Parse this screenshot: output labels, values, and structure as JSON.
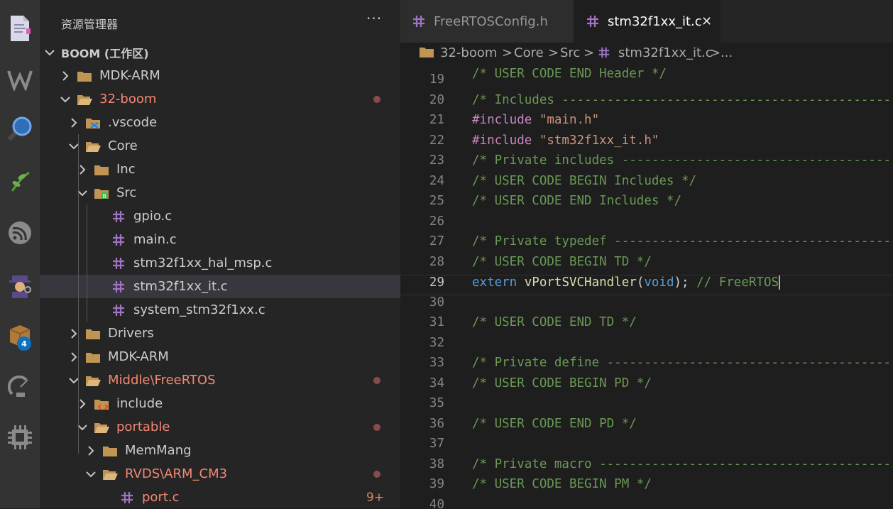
{
  "sidebar": {
    "title": "资源管理器",
    "more": "···",
    "workspace": "BOOM (工作区)",
    "items": [
      {
        "label": "MDK-ARM",
        "color": "#cccccc",
        "chev": "right",
        "icon": "folder-icon"
      },
      {
        "label": "32-boom",
        "color": "#f48771",
        "chev": "down",
        "icon": "folder-open-icon",
        "dot": true
      },
      {
        "label": ".vscode",
        "color": "#cccccc",
        "chev": "right",
        "icon": "vscode-folder-icon"
      },
      {
        "label": "Core",
        "color": "#cccccc",
        "chev": "down",
        "icon": "folder-open-icon"
      },
      {
        "label": "Inc",
        "color": "#cccccc",
        "chev": "right",
        "icon": "folder-icon"
      },
      {
        "label": "Src",
        "color": "#cccccc",
        "chev": "down",
        "icon": "src-folder-icon"
      },
      {
        "label": "gpio.c",
        "color": "#cccccc",
        "icon": "c-file-icon"
      },
      {
        "label": "main.c",
        "color": "#cccccc",
        "icon": "c-file-icon"
      },
      {
        "label": "stm32f1xx_hal_msp.c",
        "color": "#cccccc",
        "icon": "c-file-icon"
      },
      {
        "label": "stm32f1xx_it.c",
        "color": "#cccccc",
        "icon": "c-file-icon",
        "selected": true
      },
      {
        "label": "system_stm32f1xx.c",
        "color": "#cccccc",
        "icon": "c-file-icon"
      },
      {
        "label": "Drivers",
        "color": "#cccccc",
        "chev": "right",
        "icon": "folder-icon"
      },
      {
        "label": "MDK-ARM",
        "color": "#cccccc",
        "chev": "right",
        "icon": "folder-icon"
      },
      {
        "label": "Middle\\FreeRTOS",
        "color": "#f48771",
        "chev": "down",
        "icon": "folder-open-icon",
        "dot": true
      },
      {
        "label": "include",
        "color": "#cccccc",
        "chev": "right",
        "icon": "include-folder-icon"
      },
      {
        "label": "portable",
        "color": "#f48771",
        "chev": "down",
        "icon": "folder-open-icon",
        "dot": true
      },
      {
        "label": "MemMang",
        "color": "#cccccc",
        "chev": "right",
        "icon": "folder-icon"
      },
      {
        "label": "RVDS\\ARM_CM3",
        "color": "#f48771",
        "chev": "down",
        "icon": "folder-open-icon",
        "dot": true
      },
      {
        "label": "port.c",
        "color": "#f48771",
        "icon": "c-file-icon",
        "count": "9+"
      }
    ]
  },
  "activity": {
    "badge": "4",
    "icons": [
      "explorer-icon",
      "wakatime-icon",
      "search-icon",
      "git-branch-icon",
      "espressif-icon",
      "spy-icon",
      "extensions-icon",
      "satellite-icon",
      "chip-icon"
    ]
  },
  "tabs": [
    {
      "label": "FreeRTOSConfig.h",
      "active": false
    },
    {
      "label": "stm32f1xx_it.c",
      "active": true,
      "close": "✕"
    }
  ],
  "breadcrumb": {
    "parts": [
      "32-boom",
      "Core",
      "Src",
      "stm32f1xx_it.c",
      "..."
    ],
    "sep": ">"
  },
  "code": {
    "current_line": 29,
    "top_fragment": "/* USER CODE END Header */",
    "lines": [
      {
        "n": "19",
        "segs": []
      },
      {
        "n": "20",
        "segs": [
          {
            "t": "/* Includes ------------------------------------------------------------------*/",
            "c": "c-cmt"
          }
        ]
      },
      {
        "n": "21",
        "segs": [
          {
            "t": "#include ",
            "c": "c-inc"
          },
          {
            "t": "\"main.h\"",
            "c": "c-str"
          }
        ]
      },
      {
        "n": "22",
        "segs": [
          {
            "t": "#include ",
            "c": "c-inc"
          },
          {
            "t": "\"stm32f1xx_it.h\"",
            "c": "c-str"
          }
        ]
      },
      {
        "n": "23",
        "segs": [
          {
            "t": "/* Private includes ----------------------------------------------------------*/",
            "c": "c-cmt"
          }
        ]
      },
      {
        "n": "24",
        "segs": [
          {
            "t": "/* USER CODE BEGIN Includes */",
            "c": "c-cmt"
          }
        ]
      },
      {
        "n": "25",
        "segs": [
          {
            "t": "/* USER CODE END Includes */",
            "c": "c-cmt"
          }
        ]
      },
      {
        "n": "26",
        "segs": []
      },
      {
        "n": "27",
        "segs": [
          {
            "t": "/* Private typedef -----------------------------------------------------------*/",
            "c": "c-cmt"
          }
        ]
      },
      {
        "n": "28",
        "segs": [
          {
            "t": "/* USER CODE BEGIN TD */",
            "c": "c-cmt"
          }
        ]
      },
      {
        "n": "29",
        "segs": [
          {
            "t": "extern ",
            "c": "c-kw"
          },
          {
            "t": "vPortSVCHandler",
            "c": "c-fn"
          },
          {
            "t": "(",
            "c": "c-plain"
          },
          {
            "t": "void",
            "c": "c-kw"
          },
          {
            "t": "); ",
            "c": "c-plain"
          },
          {
            "t": "// FreeRTOS",
            "c": "c-cmt"
          }
        ],
        "cursor": true
      },
      {
        "n": "30",
        "segs": []
      },
      {
        "n": "31",
        "segs": [
          {
            "t": "/* USER CODE END TD */",
            "c": "c-cmt"
          }
        ]
      },
      {
        "n": "32",
        "segs": []
      },
      {
        "n": "33",
        "segs": [
          {
            "t": "/* Private define ------------------------------------------------------------*/",
            "c": "c-cmt"
          }
        ]
      },
      {
        "n": "34",
        "segs": [
          {
            "t": "/* USER CODE BEGIN PD */",
            "c": "c-cmt"
          }
        ]
      },
      {
        "n": "35",
        "segs": []
      },
      {
        "n": "36",
        "segs": [
          {
            "t": "/* USER CODE END PD */",
            "c": "c-cmt"
          }
        ]
      },
      {
        "n": "37",
        "segs": []
      },
      {
        "n": "38",
        "segs": [
          {
            "t": "/* Private macro -------------------------------------------------------------*/",
            "c": "c-cmt"
          }
        ]
      },
      {
        "n": "39",
        "segs": [
          {
            "t": "/* USER CODE BEGIN PM */",
            "c": "c-cmt"
          }
        ]
      },
      {
        "n": "40",
        "segs": []
      }
    ]
  }
}
